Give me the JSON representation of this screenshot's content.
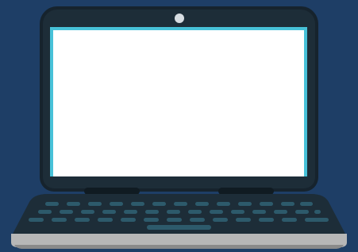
{
  "illustration": {
    "subject": "laptop",
    "colors": {
      "background": "#1e3e66",
      "bezel": "#1d2d38",
      "bezel_edge": "#16232d",
      "screen": "#ffffff",
      "screen_border": "#47c1d8",
      "camera": "#d7dde2",
      "hinge": "#101b22",
      "deck": "#1d2d38",
      "keys": "#2d5a6b",
      "base_rim": "#b7b7b7",
      "base_shadow": "#8a8a8a"
    },
    "icons": [
      "camera-icon"
    ]
  }
}
